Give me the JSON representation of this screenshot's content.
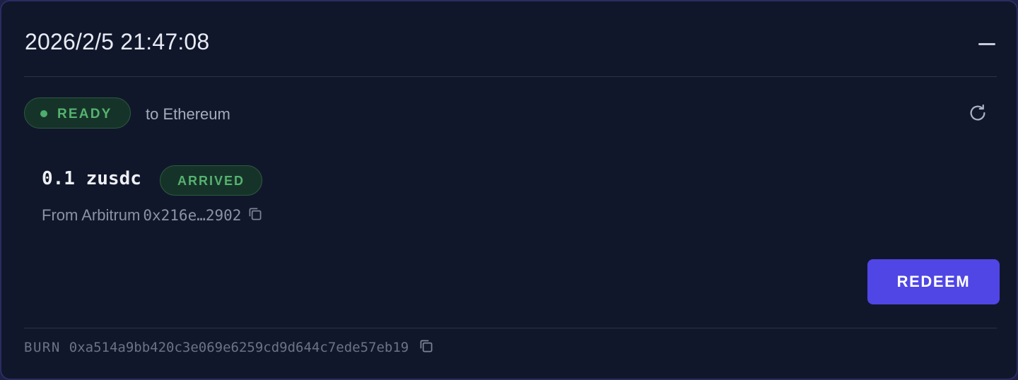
{
  "header": {
    "timestamp": "2026/2/5 21:47:08",
    "collapse_icon": "minus-icon"
  },
  "status": {
    "label": "READY",
    "destination": "to Ethereum",
    "refresh_icon": "refresh-icon",
    "color": "#55b36f"
  },
  "transfer": {
    "amount": "0.1 zusdc",
    "badge": "ARRIVED",
    "from_prefix": "From Arbitrum",
    "from_address": "0x216e…2902",
    "copy_icon": "copy-icon"
  },
  "actions": {
    "redeem_label": "REDEEM",
    "redeem_color": "#4f46e5"
  },
  "footer": {
    "burn_label": "BURN",
    "burn_hash": "0xa514a9bb420c3e069e6259cd9d644c7ede57eb19",
    "copy_icon": "copy-icon"
  }
}
